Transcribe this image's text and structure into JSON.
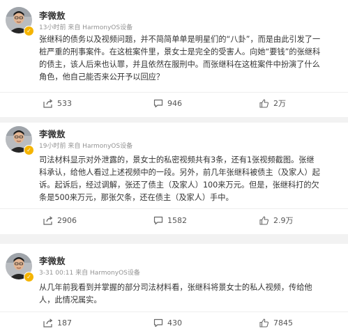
{
  "posts": [
    {
      "author": "李微敖",
      "meta": "13小时前 来自 HarmonyOS设备",
      "lines": [
        "张继科的债务以及视频问题，并不简简单单是明星们的“八卦”，而是由此引发了一",
        "桩严重的刑事案件。在这桩案件里，景女士是完全的受害人。向她“要钱”的张继科",
        "的债主，该人后来也认罪，并且依然在服刑中。而张继科在这桩案件中扮演了什么",
        "角色，他自己能否来公开予以回应？"
      ],
      "shares": "533",
      "comments": "946",
      "likes": "2万"
    },
    {
      "author": "李微敖",
      "meta": "19小时前 来自 HarmonyOS设备",
      "lines": [
        "司法材料显示对外泄露的，景女士的私密视频共有3条，还有1张视频截图。张继",
        "科承认，给他人看过上述视频中的一段。另外，前几年张继科被债主（及家人）起",
        "诉。起诉后，经过调解，张还了债主（及家人）100来万元。但是，张继科打的欠",
        "条是500来万元，那张欠条，还在债主（及家人）手中。"
      ],
      "shares": "2906",
      "comments": "1582",
      "likes": "2.9万"
    },
    {
      "author": "李微敖",
      "meta": "3-31 00:11 来自 HarmonyOS设备",
      "lines": [
        "从几年前我看到并掌握的部分司法材料看，张继科将景女士的私人视频，传给他",
        "人，此情况属实。"
      ],
      "shares": "187",
      "comments": "430",
      "likes": "7845"
    }
  ],
  "icons": {
    "verified": "verified-badge-icon",
    "share": "share-icon",
    "comment": "comment-icon",
    "like": "thumbs-up-icon"
  },
  "colors": {
    "background": "#f2f2f2",
    "card": "#ffffff",
    "text": "#333333",
    "meta": "#939393",
    "verified_badge": "#f5b400"
  }
}
